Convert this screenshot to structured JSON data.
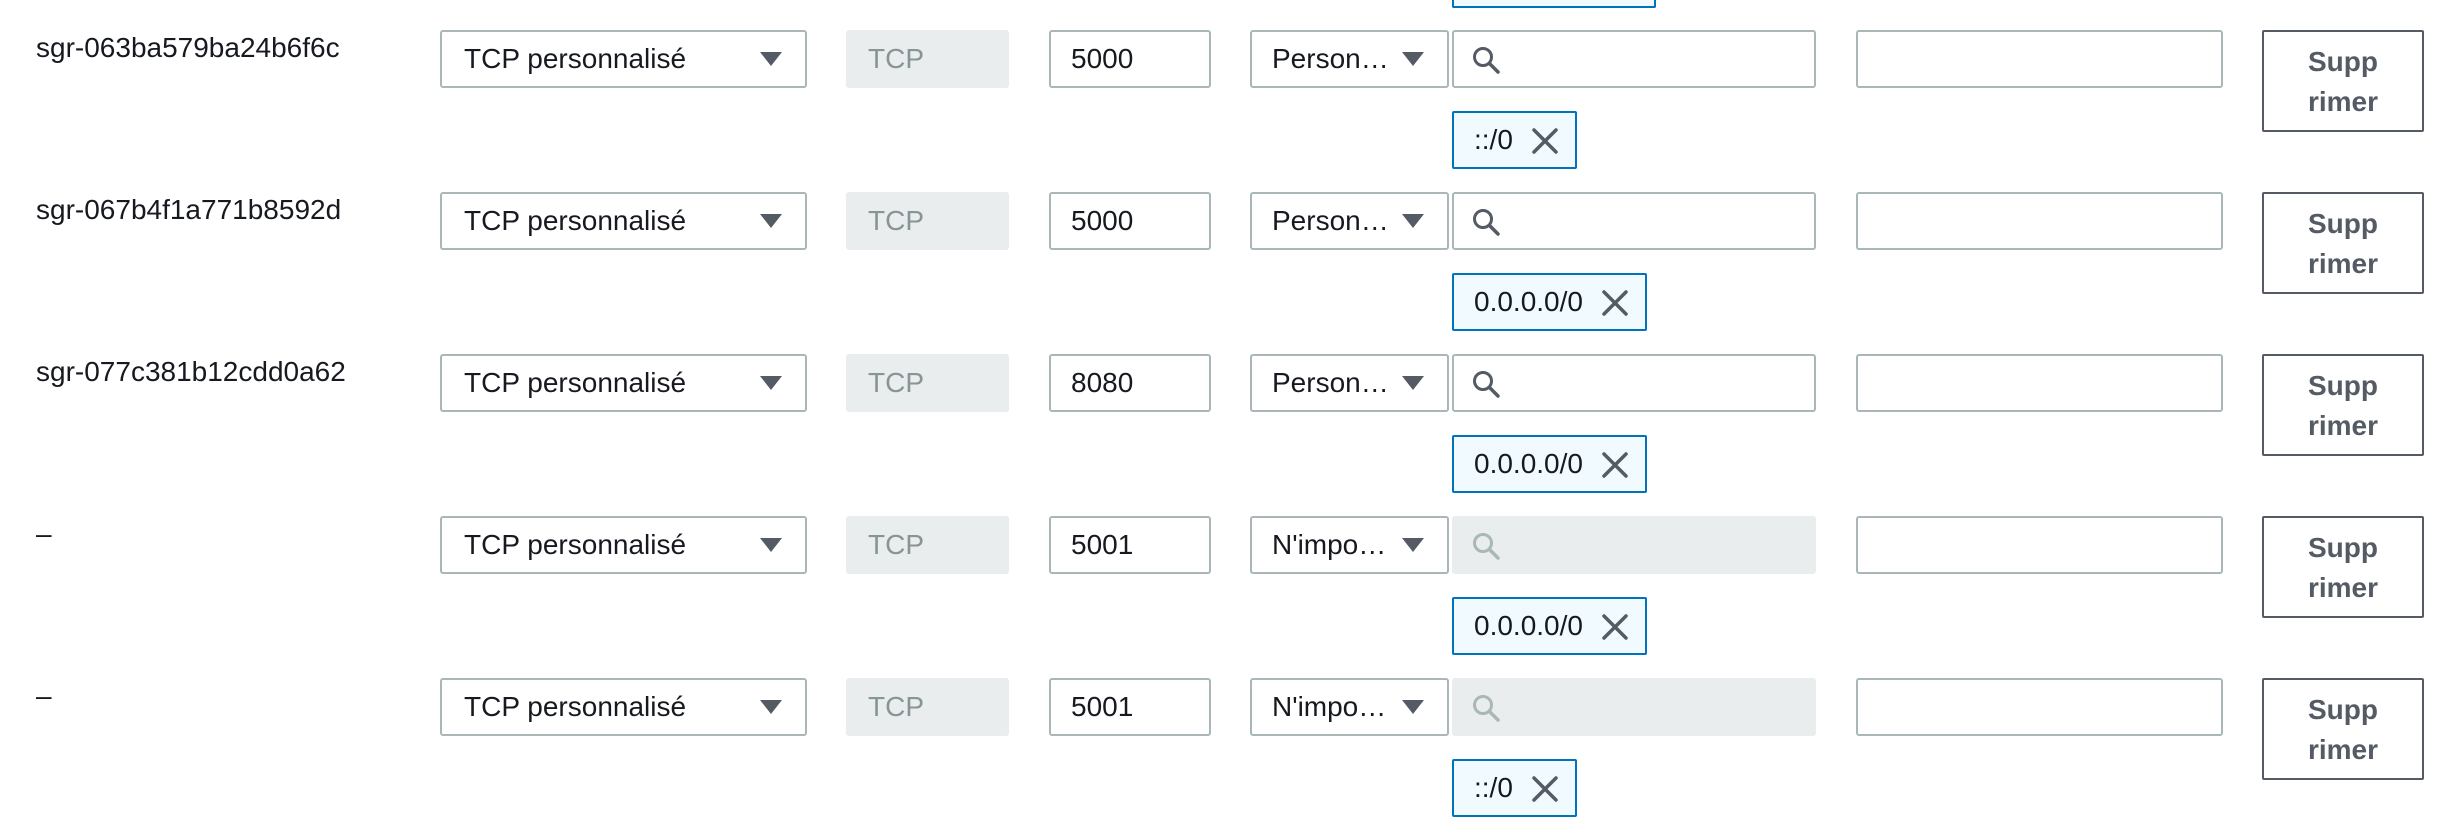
{
  "rules": [
    {
      "id": "sgr-063ba579ba24b6f6c",
      "type": "TCP personnalisé",
      "protocol": "TCP",
      "port": "5000",
      "source_type": "Person…",
      "source_search_placeholder": "",
      "source_token": "::/0",
      "description": "",
      "delete_label_1": "Supp",
      "delete_label_2": "rimer"
    },
    {
      "id": "sgr-067b4f1a771b8592d",
      "type": "TCP personnalisé",
      "protocol": "TCP",
      "port": "5000",
      "source_type": "Person…",
      "source_search_placeholder": "",
      "source_token": "0.0.0.0/0",
      "description": "",
      "delete_label_1": "Supp",
      "delete_label_2": "rimer"
    },
    {
      "id": "sgr-077c381b12cdd0a62",
      "type": "TCP personnalisé",
      "protocol": "TCP",
      "port": "8080",
      "source_type": "Person…",
      "source_search_placeholder": "",
      "source_token": "0.0.0.0/0",
      "description": "",
      "delete_label_1": "Supp",
      "delete_label_2": "rimer"
    },
    {
      "id": "–",
      "type": "TCP personnalisé",
      "protocol": "TCP",
      "port": "5001",
      "source_type": "N'impo…",
      "source_search_placeholder": "",
      "source_token": "0.0.0.0/0",
      "description": "",
      "delete_label_1": "Supp",
      "delete_label_2": "rimer"
    },
    {
      "id": "–",
      "type": "TCP personnalisé",
      "protocol": "TCP",
      "port": "5001",
      "source_type": "N'impo…",
      "source_search_placeholder": "",
      "source_token": "::/0",
      "description": "",
      "delete_label_1": "Supp",
      "delete_label_2": "rimer"
    }
  ],
  "icons": {
    "search": "search-icon",
    "remove_token": "close-icon",
    "dropdown": "caret-down-icon"
  },
  "colors": {
    "token_border": "#0073bb",
    "token_bg": "#f1faff",
    "disabled_bg": "#eaeded",
    "input_border": "#aab7b8",
    "button_text": "#545b64"
  }
}
